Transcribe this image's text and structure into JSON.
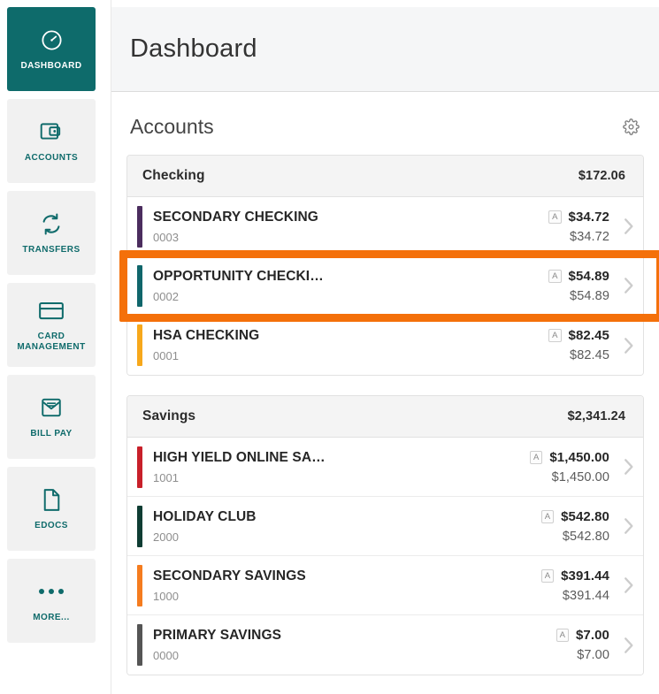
{
  "sidebar": {
    "items": [
      {
        "label": "DASHBOARD",
        "icon": "gauge-icon",
        "active": true
      },
      {
        "label": "ACCOUNTS",
        "icon": "wallet-icon",
        "active": false
      },
      {
        "label": "TRANSFERS",
        "icon": "transfer-arrows-icon",
        "active": false
      },
      {
        "label": "CARD MANAGEMENT",
        "icon": "credit-card-icon",
        "active": false
      },
      {
        "label": "BILL PAY",
        "icon": "envelope-icon",
        "active": false
      },
      {
        "label": "EDOCS",
        "icon": "document-icon",
        "active": false
      },
      {
        "label": "MORE...",
        "icon": "ellipsis-icon",
        "active": false
      }
    ]
  },
  "header": {
    "title": "Dashboard"
  },
  "accounts_section": {
    "title": "Accounts",
    "settings_icon": "gear-icon"
  },
  "colors": {
    "brand_teal": "#0e6b6b",
    "highlight_orange": "#f4700a",
    "bar_secondary_checking": "#4b2d5e",
    "bar_opportunity_checking": "#10666b",
    "bar_hsa_checking": "#f7a81b",
    "bar_high_yield": "#c8202a",
    "bar_holiday_club": "#0f3d33",
    "bar_secondary_savings": "#f57c1f",
    "bar_primary_savings": "#555555"
  },
  "groups": [
    {
      "name": "Checking",
      "total": "$172.06",
      "rows": [
        {
          "name": "SECONDARY CHECKING",
          "number": "0003",
          "badge": "A",
          "balance": "$34.72",
          "available": "$34.72",
          "bar_color": "#4b2d5e",
          "highlighted": false
        },
        {
          "name": "OPPORTUNITY CHECKI…",
          "number": "0002",
          "badge": "A",
          "balance": "$54.89",
          "available": "$54.89",
          "bar_color": "#10666b",
          "highlighted": true
        },
        {
          "name": "HSA CHECKING",
          "number": "0001",
          "badge": "A",
          "balance": "$82.45",
          "available": "$82.45",
          "bar_color": "#f7a81b",
          "highlighted": false
        }
      ]
    },
    {
      "name": "Savings",
      "total": "$2,341.24",
      "rows": [
        {
          "name": "HIGH YIELD ONLINE SA…",
          "number": "1001",
          "badge": "A",
          "balance": "$1,450.00",
          "available": "$1,450.00",
          "bar_color": "#c8202a",
          "highlighted": false
        },
        {
          "name": "HOLIDAY CLUB",
          "number": "2000",
          "badge": "A",
          "balance": "$542.80",
          "available": "$542.80",
          "bar_color": "#0f3d33",
          "highlighted": false
        },
        {
          "name": "SECONDARY SAVINGS",
          "number": "1000",
          "badge": "A",
          "balance": "$391.44",
          "available": "$391.44",
          "bar_color": "#f57c1f",
          "highlighted": false
        },
        {
          "name": "PRIMARY SAVINGS",
          "number": "0000",
          "badge": "A",
          "balance": "$7.00",
          "available": "$7.00",
          "bar_color": "#555555",
          "highlighted": false
        }
      ]
    }
  ]
}
